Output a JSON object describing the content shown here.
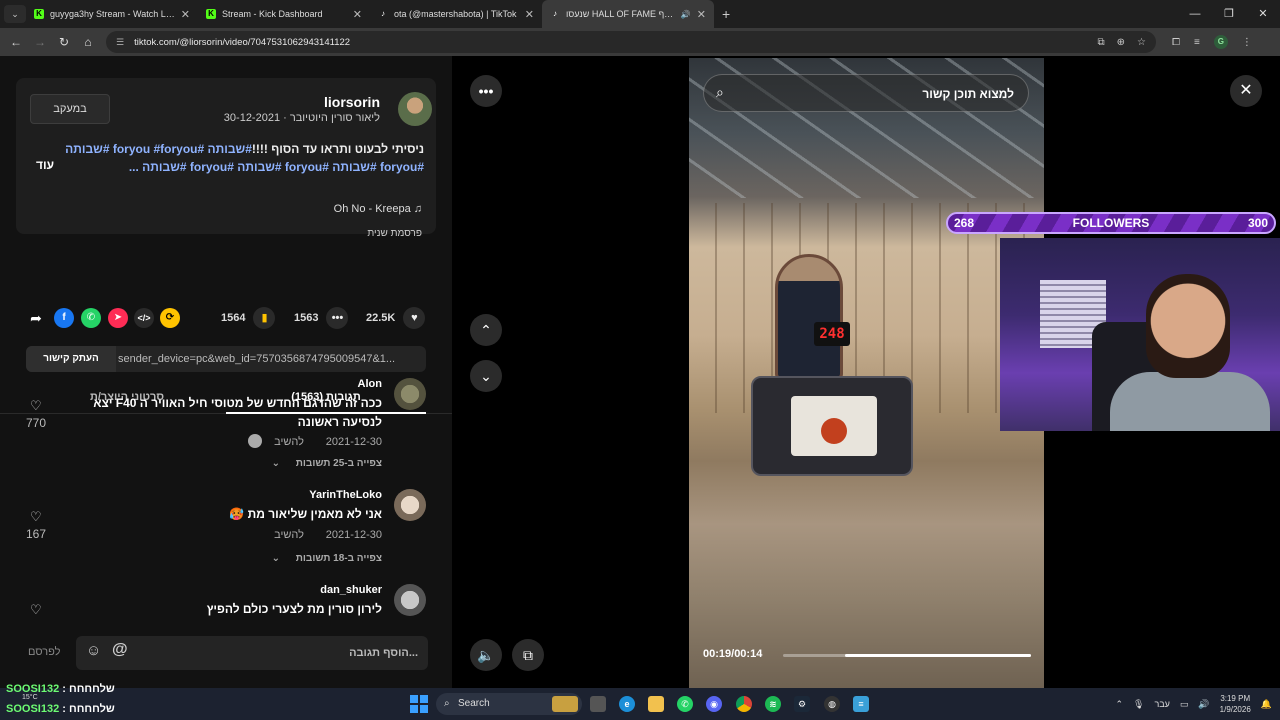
{
  "browser": {
    "tabs": [
      {
        "title": "guyyga3hy Stream - Watch Live",
        "fav": "K",
        "fav_color": "#53fc18"
      },
      {
        "title": "Stream - Kick Dashboard",
        "fav": "K",
        "fav_color": "#53fc18"
      },
      {
        "title": "ota (@mastershabota) | TikTok",
        "fav": "♪",
        "fav_color": "#ffffff"
      },
      {
        "title": "שנעסו HALL OF FAME אוסף",
        "fav": "♪",
        "fav_color": "#ffffff"
      }
    ],
    "url": "tiktok.com/@liorsorin/video/7047531062943141122",
    "profile_letter": "G"
  },
  "post": {
    "follow_label": "במעקב",
    "username": "liorsorin",
    "subline": "ליאור סורין היוטיובר · 30-12-2021",
    "desc_text": "ניסיתי לבעוט ותראו עד הסוף !!!!",
    "hashtags_line1": "#שבותה #foryou #foryou #שבותה",
    "hashtags_line2": "#foryou #שבותה #foryou #שבותה #foryou #שבותה ...",
    "more_label": "עוד",
    "music": "Oh No - Kreepa ♫",
    "pinned": "פרסמת שנית"
  },
  "stats": {
    "likes": "22.5K",
    "comments": "1563",
    "saves": "1564"
  },
  "link": {
    "copy_label": "העתק קישור",
    "text": "...1&sender_device=pc&web_id=7570356874795009547"
  },
  "tabs": {
    "comments": "(1563) תגובות",
    "creator_videos": "סרטוני היוצר/ת"
  },
  "comments": [
    {
      "name": "Alon",
      "text": "ככה זה שהדגם החדש של מטוסי חיל האוויר ה F40 יצא לנסיעה ראשונה",
      "date": "2021-12-30",
      "reply": "להשיב",
      "thread": "צפייה ב-25 תשובות",
      "likes": "770"
    },
    {
      "name": "YarinTheLoko",
      "text": "אני לא מאמין שליאור מת 🥵",
      "date": "2021-12-30",
      "reply": "להשיב",
      "thread": "צפייה ב-18 תשובות",
      "likes": "167"
    },
    {
      "name": "dan_shuker",
      "text": "לירון סורין מת לצערי כולם להפיץ",
      "date": "",
      "reply": "",
      "thread": "",
      "likes": ""
    }
  ],
  "composer": {
    "placeholder": "הוסף תגובה...",
    "post_label": "לפרסם"
  },
  "player": {
    "search_text": "למצוא תוכן קשור",
    "time": "00:19/00:14",
    "progress": 0.75,
    "scoreboard": "248"
  },
  "overlay": {
    "followers_current": "268",
    "followers_label": "FOLLOWERS",
    "followers_goal": "300"
  },
  "chat": [
    {
      "name": "SOOSI132",
      "msg": ": שלחחחח"
    },
    {
      "name": "SOOSI132",
      "msg": ": שלחחחח"
    }
  ],
  "taskbar": {
    "search": "Search",
    "weather": "15°C",
    "lang": "עבר",
    "time": "3:19 PM",
    "date": "1/9/2026"
  }
}
